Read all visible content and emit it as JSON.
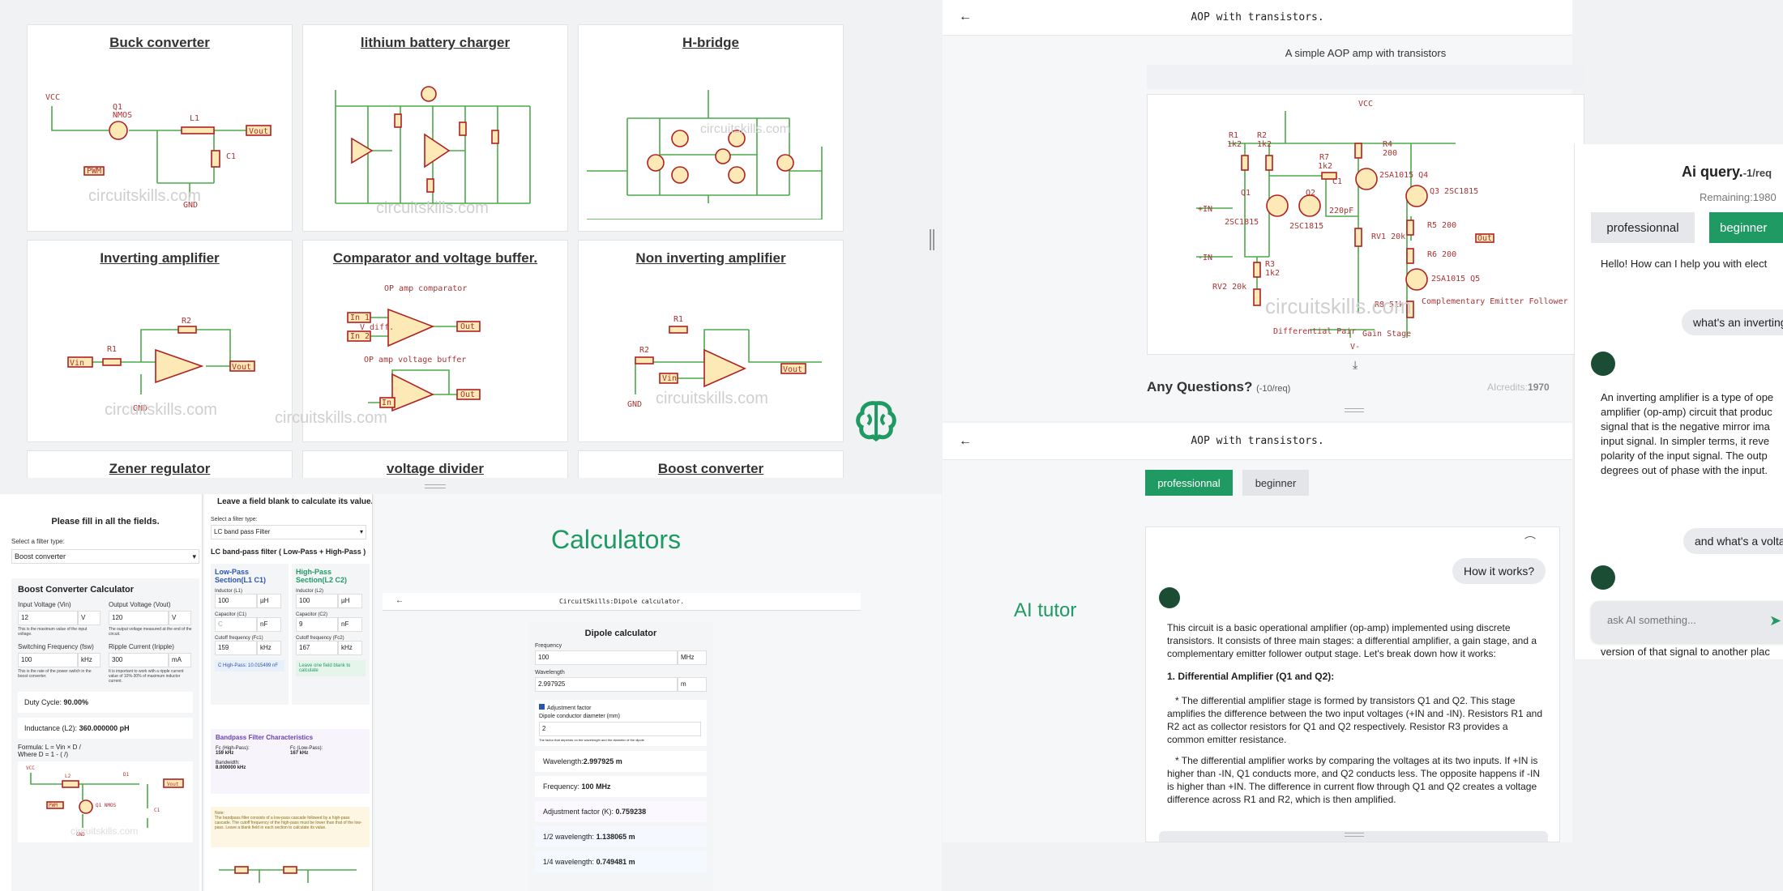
{
  "gallery": {
    "cards": [
      {
        "title": "Buck converter"
      },
      {
        "title": "lithium battery charger"
      },
      {
        "title": "H-bridge"
      },
      {
        "title": "Inverting amplifier"
      },
      {
        "title": "Comparator and voltage buffer."
      },
      {
        "title": "Non inverting amplifier"
      },
      {
        "title": "Zener regulator"
      },
      {
        "title": "voltage divider"
      },
      {
        "title": "Boost converter"
      }
    ],
    "watermark": "circuitskills.com",
    "schematic_labels": {
      "vcc": "VCC",
      "q1": "Q1",
      "nmos": "NMOS",
      "l1": "L1",
      "c1": "C1",
      "vout": "Vout",
      "pwm": "PWM",
      "gnd": "GND",
      "vin": "Vin",
      "r1": "R1",
      "r2": "R2",
      "opamp_comparator": "OP amp comparator",
      "opamp_buffer": "OP amp voltage buffer",
      "in1": "In 1",
      "in2": "In 2",
      "vdiff": "V diff.",
      "out": "Out",
      "in": "In"
    }
  },
  "aop_top": {
    "header_title": "AOP with transistors.",
    "caption": "A simple AOP amp with transistors",
    "question_title": "Any Questions?",
    "question_cost": "(-10/req)",
    "credits_label": "AIcredits:",
    "credits_value": "1970",
    "schematic_labels": {
      "vcc": "VCC",
      "r1": "R1",
      "r1v": "1k2",
      "r2": "R2",
      "r2v": "1k2",
      "r7": "R7",
      "r7v": "1k2",
      "r4": "R4",
      "r4v": "200",
      "q4": "2SA1015 Q4",
      "q3": "Q3 2SC1815",
      "c1": "C1",
      "c1v": "220pF",
      "q1": "Q1",
      "q1t": "2SC1815",
      "q2": "Q2",
      "q2t": "2SC1815",
      "r3": "R3",
      "r3v": "1k2",
      "rv1": "RV1 20k",
      "r5": "R5 200",
      "r6": "R6 200",
      "rv2": "RV2 20k",
      "r8": "R8 51k",
      "q5": "2SA1015 Q5",
      "inp": "+IN",
      "inn": "-IN",
      "out": "Out",
      "diff": "Differential Pair",
      "gain": "Gain Stage",
      "cef": "Complementary Emitter Follower",
      "vminus": "V-"
    }
  },
  "aop_bottom": {
    "header_title": "AOP with transistors.",
    "mode_professional": "professionnal",
    "mode_beginner": "beginner",
    "tutor_label": "AI tutor",
    "user_question": "How it works?",
    "answer_intro": "This circuit is a basic operational amplifier (op-amp) implemented using discrete transistors. It consists of three main stages: a differential amplifier, a gain stage, and a complementary emitter follower output stage. Let's break down how it works:",
    "answer_heading": "1.  Differential Amplifier (Q1 and Q2):",
    "answer_p1": "*   The differential amplifier stage is formed by transistors Q1 and Q2. This stage amplifies the difference between the two input voltages (+IN and -IN). Resistors R1 and R2 act as collector resistors for Q1 and Q2 respectively. Resistor R3 provides a common emitter resistance.",
    "answer_p2": "*   The differential amplifier works by comparing the voltages at its two inputs. If +IN is higher than -IN, Q1 conducts more, and Q2 conducts less. The opposite happens if -IN is higher than +IN. The difference in current flow through Q1 and Q2 creates a voltage difference across R1 and R2, which is then amplified."
  },
  "ai_query": {
    "title": "Ai query.",
    "cost": "-1/req",
    "remaining_label": "Remaining:",
    "remaining_value": "1980",
    "mode_professional": "professionnal",
    "mode_beginner": "beginner",
    "greeting": "Hello!  How can I help you with elect",
    "user_msg1": "what's an inverting",
    "answer": "An inverting amplifier is a type of ope amplifier (op-amp) circuit that produc signal that is the negative mirror ima input signal.  In simpler terms, it reve polarity of the input signal.  The outp degrees out of phase with the input.",
    "user_msg2": "and what's a volta",
    "input_placeholder": "ask AI something...",
    "overflow_text": "version of that signal to another plac significantly affecting the original sig"
  },
  "boost_calc": {
    "form_title": "Please fill in all the fields.",
    "select_label": "Select a filter type:",
    "select_value": "Boost converter",
    "calc_title": "Boost Converter Calculator",
    "vin_label": "Input Voltage (Vin)",
    "vin_value": "12",
    "vin_unit": "V",
    "vin_help": "This is the maximum value of the input voltage.",
    "vout_label": "Output Voltage (Vout)",
    "vout_value": "120",
    "vout_unit": "V",
    "vout_help": "The output voltage measured at the end of the circuit.",
    "fsw_label": "Switching Frequency (fsw)",
    "fsw_value": "100",
    "fsw_unit": "kHz",
    "fsw_help": "This is the rate of the power switch in the boost converter.",
    "ripple_label": "Ripple Current (Iripple)",
    "ripple_value": "300",
    "ripple_unit": "mA",
    "ripple_help": "It is important to work with a ripple current value of 10%-30% of maximum inductor current.",
    "duty_label": "Duty Cycle:",
    "duty_value": "90.00%",
    "ind_label": "Inductance (L2):",
    "ind_value": "360.000000 pH",
    "formula1": "Formula: L = Vin × D /",
    "formula2": "Where D = 1 - (",
    "formula2b": "/",
    "formula2c": ")",
    "sch": {
      "vcc": "VCC",
      "l2": "L2",
      "d1": "D1",
      "vout": "Vout",
      "pwm": "PWM",
      "q1": "Q1 NMOS",
      "c1": "C1",
      "gnd": "GND"
    }
  },
  "lc_calc": {
    "hint": "Leave a field blank to calculate its value.",
    "select_label": "Select a filter type:",
    "select_value": "LC band pass Filter",
    "title": "LC band-pass filter ( Low-Pass + High-Pass )",
    "low_title": "Low-Pass Section(L1 C1)",
    "high_title": "High-Pass Section(L2 C2)",
    "l1_label": "Inductor (L1)",
    "l1_value": "100",
    "l1_unit": "µH",
    "l2_label": "Inductor (L2)",
    "l2_value": "100",
    "l2_unit": "µH",
    "c1_label": "Capacitor (C1)",
    "c1_value": "C",
    "c1_unit": "nF",
    "c2_label": "Capacitor (C2)",
    "c2_value": "9",
    "c2_unit": "nF",
    "f1_label": "Cutoff frequency (Fc1)",
    "f1_value": "159",
    "f1_unit": "kHz",
    "f2_label": "Cutoff frequency (Fc2)",
    "f2_value": "167",
    "f2_unit": "kHz",
    "result_low": "C High-Pass: 10.015499 nF",
    "result_high": "Leave one field blank to calculate",
    "char_title": "Bandpass Filter Characteristics",
    "fc_hp_label": "Fc (High-Pass):",
    "fc_hp_value": "159 kHz",
    "fc_lp_label": "Fc (Low-Pass):",
    "fc_lp_value": "167 kHz",
    "bw_label": "Bandwidth:",
    "bw_value": "8.000000 kHz",
    "note_title": "Note:",
    "note_text": "The bandpass filter consists of a low-pass cascade followed by a high-pass cascade. The cutoff frequency of the high-pass must be lower than that of the low-pass. Leave a blank field in each section to calculate its value."
  },
  "calculators": {
    "heading": "Calculators",
    "dipole_header": "CircuitSkills:Dipole calculator.",
    "dipole_title": "Dipole calculator",
    "freq_label": "Frequency",
    "freq_value": "100",
    "freq_unit": "MHz",
    "wl_label": "Wavelength",
    "wl_value": "2.997925",
    "wl_unit": "m",
    "adj_label": "Adjustment factor",
    "diam_label": "Dipole conductor diameter (mm)",
    "diam_value": "2",
    "diam_help": "The factor that depends on the wavelength and the diameter of the dipole",
    "res_wl_label": "Wavelength:",
    "res_wl_value": "2.997925 m",
    "res_freq_label": "Frequency:",
    "res_freq_value": "100 MHz",
    "res_adj_label": "Adjustment factor (K):",
    "res_adj_value": "0.759238",
    "res_half_label": "1/2 wavelength:",
    "res_half_value": "1.138065 m",
    "res_quarter_label": "1/4 wavelength:",
    "res_quarter_value": "0.749481 m"
  },
  "colors": {
    "accent": "#1f9a63",
    "brand_text": "#1f9a63",
    "purple": "#6a3fb5"
  }
}
